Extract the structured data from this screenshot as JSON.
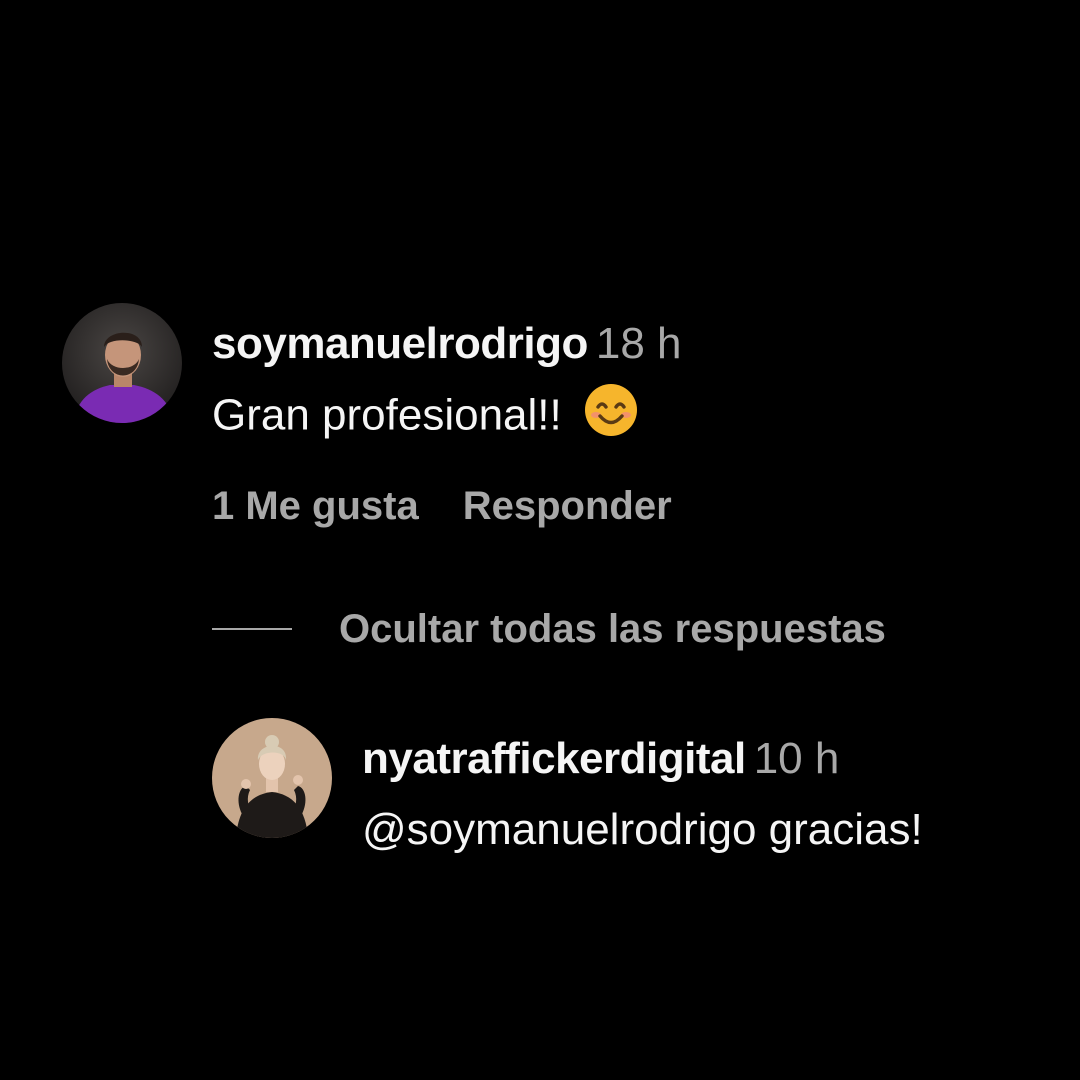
{
  "colors": {
    "background": "#000000",
    "primary_text": "#f5f5f5",
    "secondary_text": "#a8a8a8",
    "emoji": "#f6b52c"
  },
  "comment": {
    "username": "soymanuelrodrigo",
    "time": "18 h",
    "text": "Gran profesional!!",
    "emoji_icon": "smiling-face-icon",
    "likes_label": "1 Me gusta",
    "reply_label": "Responder"
  },
  "hide_replies_label": "Ocultar todas las respuestas",
  "reply": {
    "username": "nyatraffickerdigital",
    "time": "10 h",
    "text": "@soymanuelrodrigo gracias!"
  }
}
